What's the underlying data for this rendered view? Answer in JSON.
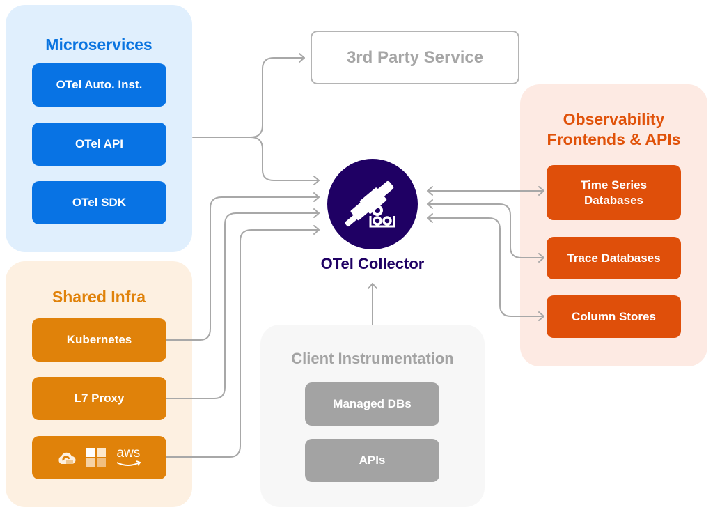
{
  "microservices": {
    "title": "Microservices",
    "items": [
      "OTel Auto. Inst.",
      "OTel API",
      "OTel SDK"
    ]
  },
  "shared_infra": {
    "title": "Shared Infra",
    "items": [
      "Kubernetes",
      "L7 Proxy"
    ],
    "cloud_icons": [
      "google-cloud-icon",
      "microsoft-azure-icon",
      "aws-icon"
    ],
    "aws_label": "aws"
  },
  "third_party": {
    "label": "3rd Party Service"
  },
  "collector": {
    "label": "OTel Collector",
    "icon": "telescope-icon"
  },
  "observability": {
    "title_line1": "Observability",
    "title_line2": "Frontends & APIs",
    "items": [
      "Time Series Databases",
      "Trace Databases",
      "Column Stores"
    ],
    "ts_line1": "Time Series",
    "ts_line2": "Databases"
  },
  "client": {
    "title": "Client Instrumentation",
    "items": [
      "Managed DBs",
      "APIs"
    ]
  },
  "colors": {
    "microservices": "#0873e4",
    "shared_infra": "#e0820a",
    "observability": "#df4f0a",
    "client": "#a3a3a3",
    "collector": "#1f0064",
    "connector": "#a8a8a8"
  }
}
